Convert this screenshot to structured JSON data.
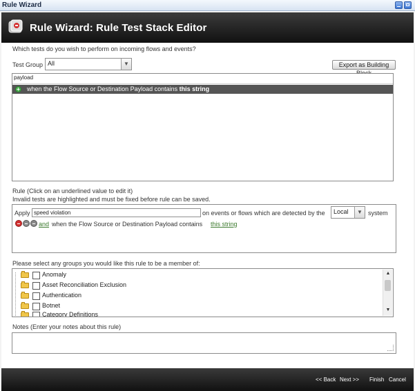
{
  "window": {
    "title": "Rule Wizard"
  },
  "header": {
    "title": "Rule Wizard: Rule Test Stack Editor"
  },
  "tests": {
    "question": "Which tests do you wish to perform on incoming flows and events?",
    "group_label": "Test Group",
    "group_value": "All",
    "export_button": "Export as Building Block",
    "filter_value": "payload",
    "selected_test_prefix": "when the Flow Source or Destination Payload contains",
    "selected_test_bold": "this string"
  },
  "rule": {
    "heading": "Rule (Click on an underlined value to edit it)",
    "invalid_note": "Invalid tests are highlighted and must be fixed before rule can be saved.",
    "apply_label": "Apply",
    "rule_name": "speed violation",
    "detected_text": "on events or flows which are detected by the",
    "scope_value": "Local",
    "system_label": "system",
    "and_link": "and",
    "clause_text": "when the Flow Source or Destination Payload contains",
    "clause_link": "this string"
  },
  "groups": {
    "heading": "Please select any groups you would like this rule to be a member of:",
    "items": [
      "Anomaly",
      "Asset Reconciliation Exclusion",
      "Authentication",
      "Botnet",
      "Category Definitions"
    ]
  },
  "notes": {
    "heading": "Notes (Enter your notes about this rule)",
    "value": ""
  },
  "footer": {
    "back": "<< Back",
    "next": "Next >>",
    "finish": "Finish",
    "cancel": "Cancel"
  }
}
